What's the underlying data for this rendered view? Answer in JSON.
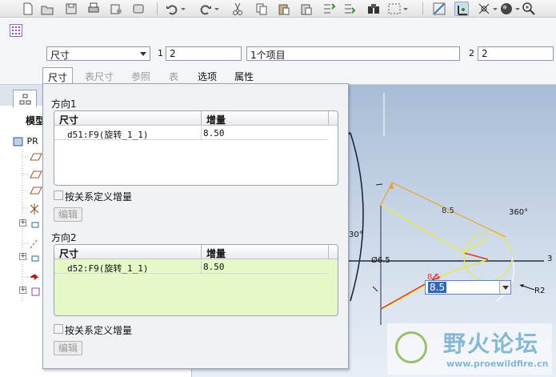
{
  "toolbar": {
    "icons": [
      "new-file-icon",
      "open-file-icon",
      "save-icon",
      "print-icon",
      "send-icon",
      "repaint-icon",
      "undo-icon",
      "redo-icon",
      "cut-icon",
      "copy-icon",
      "paste-icon",
      "paste-special-icon",
      "regenerate-icon",
      "regen-manager-icon",
      "find-icon",
      "select-box-icon",
      "datum-display-icon",
      "datum-axis-icon",
      "spin-center-icon",
      "shading-icon",
      "zoom-in-icon"
    ]
  },
  "dashboard": {
    "type_select": "尺寸",
    "dir1_number": "1",
    "dir1_count": "2",
    "items_field": "1个项目",
    "dir2_number": "2",
    "dir2_count": "2",
    "tabs": [
      {
        "label": "尺寸",
        "state": "active"
      },
      {
        "label": "表尺寸",
        "state": "disabled"
      },
      {
        "label": "参照",
        "state": "disabled"
      },
      {
        "label": "表",
        "state": "disabled"
      },
      {
        "label": "选项",
        "state": "normal"
      },
      {
        "label": "属性",
        "state": "normal"
      }
    ]
  },
  "model_tree": {
    "title": "模型",
    "root_label": "PR"
  },
  "panel": {
    "direction1": {
      "title": "方向1",
      "headers": {
        "dim": "尺寸",
        "inc": "增量"
      },
      "rows": [
        {
          "dim": "d51:F9(旋转_1_1)",
          "inc": "8.50"
        }
      ],
      "checkbox_label": "按关系定义增量",
      "edit_button": "编辑"
    },
    "direction2": {
      "title": "方向2",
      "headers": {
        "dim": "尺寸",
        "inc": "增量"
      },
      "rows": [
        {
          "dim": "d52:F9(旋转_1_1)",
          "inc": "8.50"
        }
      ],
      "checkbox_label": "按关系定义增量",
      "edit_button": "编辑"
    }
  },
  "graphics": {
    "dim_angle_top": "8.5",
    "dim_360": "360°",
    "dim_30": "30°",
    "dim_diam": "Ø6.5",
    "dim_angle_bottom": "8.5",
    "dim_r2": "R2",
    "dim_right": "3",
    "dim_input_value": "8.5"
  },
  "watermark": {
    "title": "野火论坛",
    "url": "www.proewildfire.cn"
  },
  "colors": {
    "accent": "#3468b0",
    "dim_yellow": "#e8e84a",
    "dim_red": "#d83a2a",
    "dim_orange": "#f0a030",
    "green_table": "#e4f8c8"
  }
}
